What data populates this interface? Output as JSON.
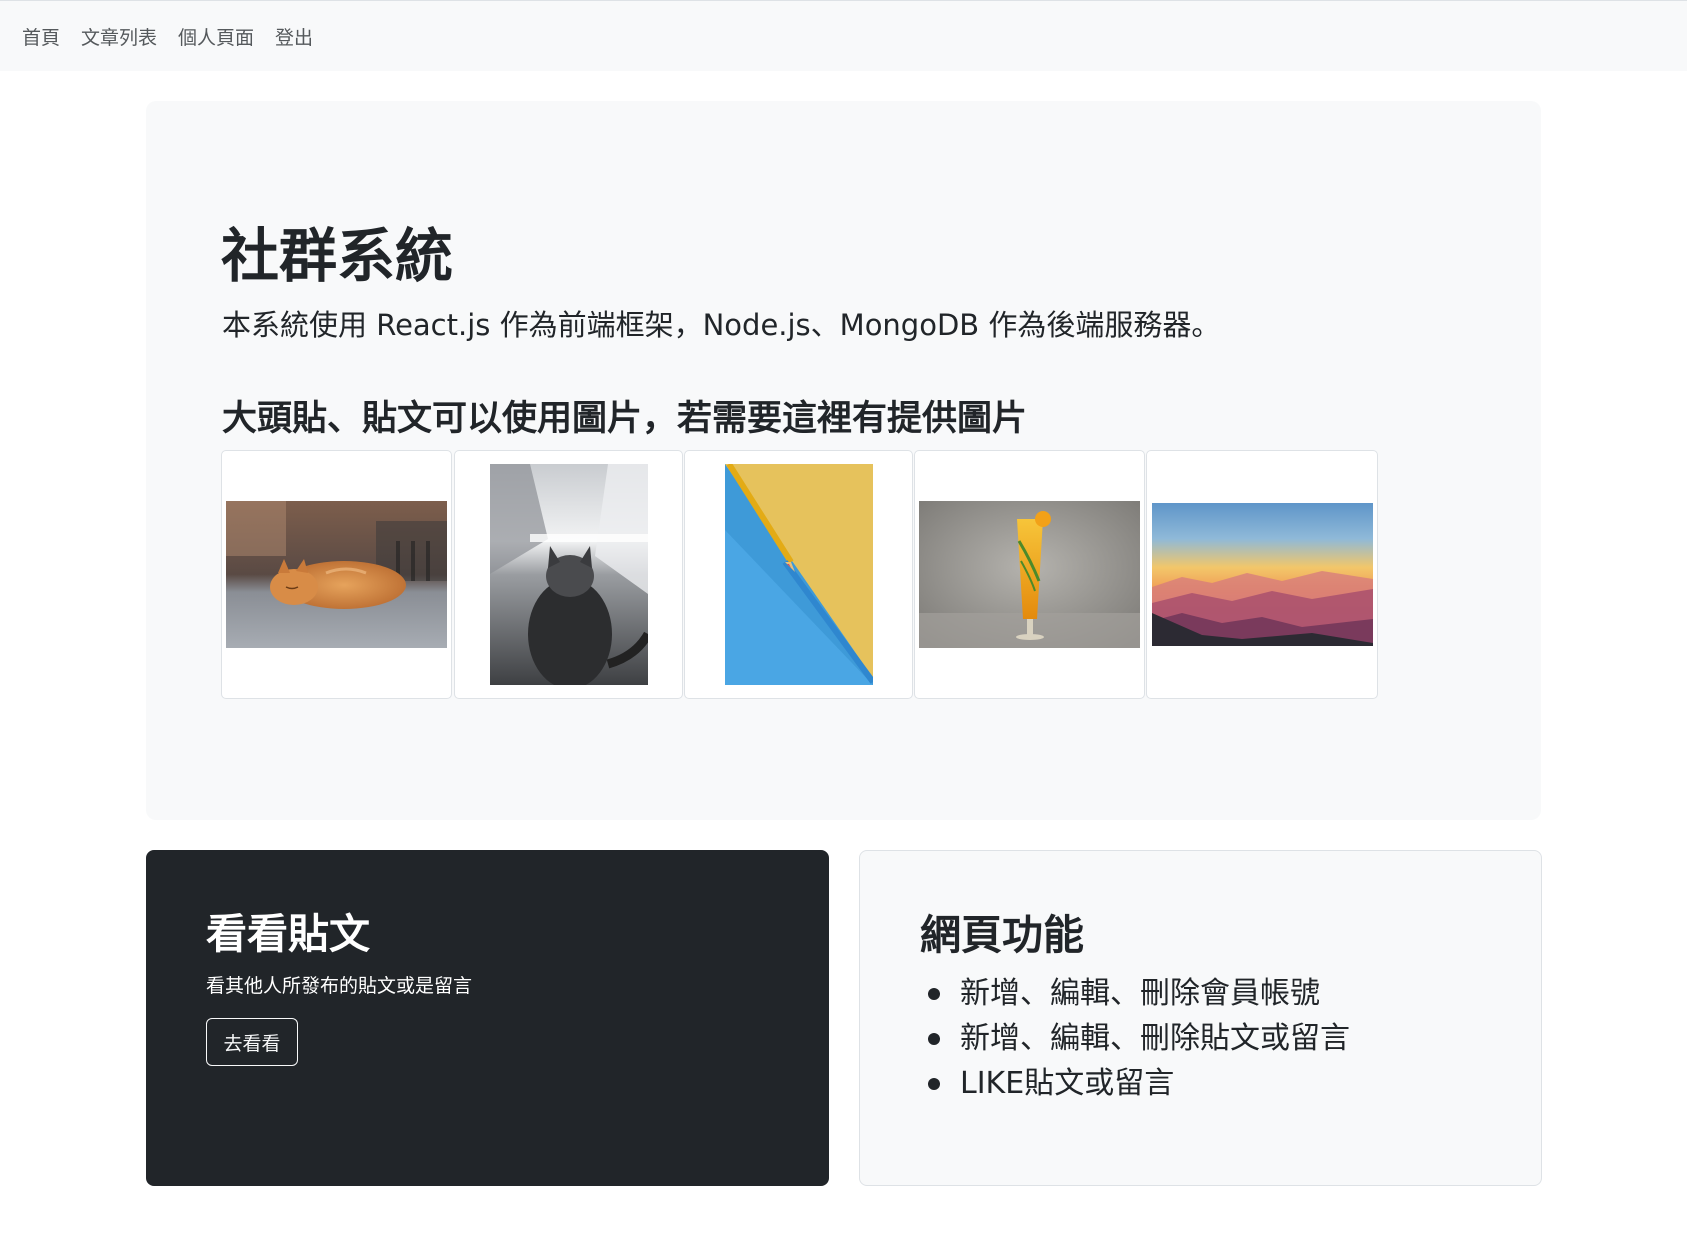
{
  "navbar": {
    "links": [
      "首頁",
      "文章列表",
      "個人頁面",
      "登出"
    ]
  },
  "hero": {
    "title": "社群系統",
    "lead": "本系統使用 React.js 作為前端框架，Node.js、MongoDB 作為後端服務器。",
    "subtitle": "大頭貼、貼文可以使用圖片，若需要這裡有提供圖片",
    "images": [
      {
        "subject": "sleeping orange cat"
      },
      {
        "subject": "gray cat looking up at window"
      },
      {
        "subject": "yellow and blue pencils"
      },
      {
        "subject": "yellow cocktail drink"
      },
      {
        "subject": "mountain sunset landscape"
      }
    ]
  },
  "posts_card": {
    "title": "看看貼文",
    "text": "看其他人所發布的貼文或是留言",
    "button_label": "去看看"
  },
  "features_card": {
    "title": "網頁功能",
    "items": [
      "新增、編輯、刪除會員帳號",
      "新增、編輯、刪除貼文或留言",
      "LIKE貼文或留言"
    ]
  },
  "colors": {
    "navbar_bg": "#f8f9fa",
    "panel_bg": "#f8f9fa",
    "dark_card_bg": "#212529",
    "text": "#212529"
  }
}
